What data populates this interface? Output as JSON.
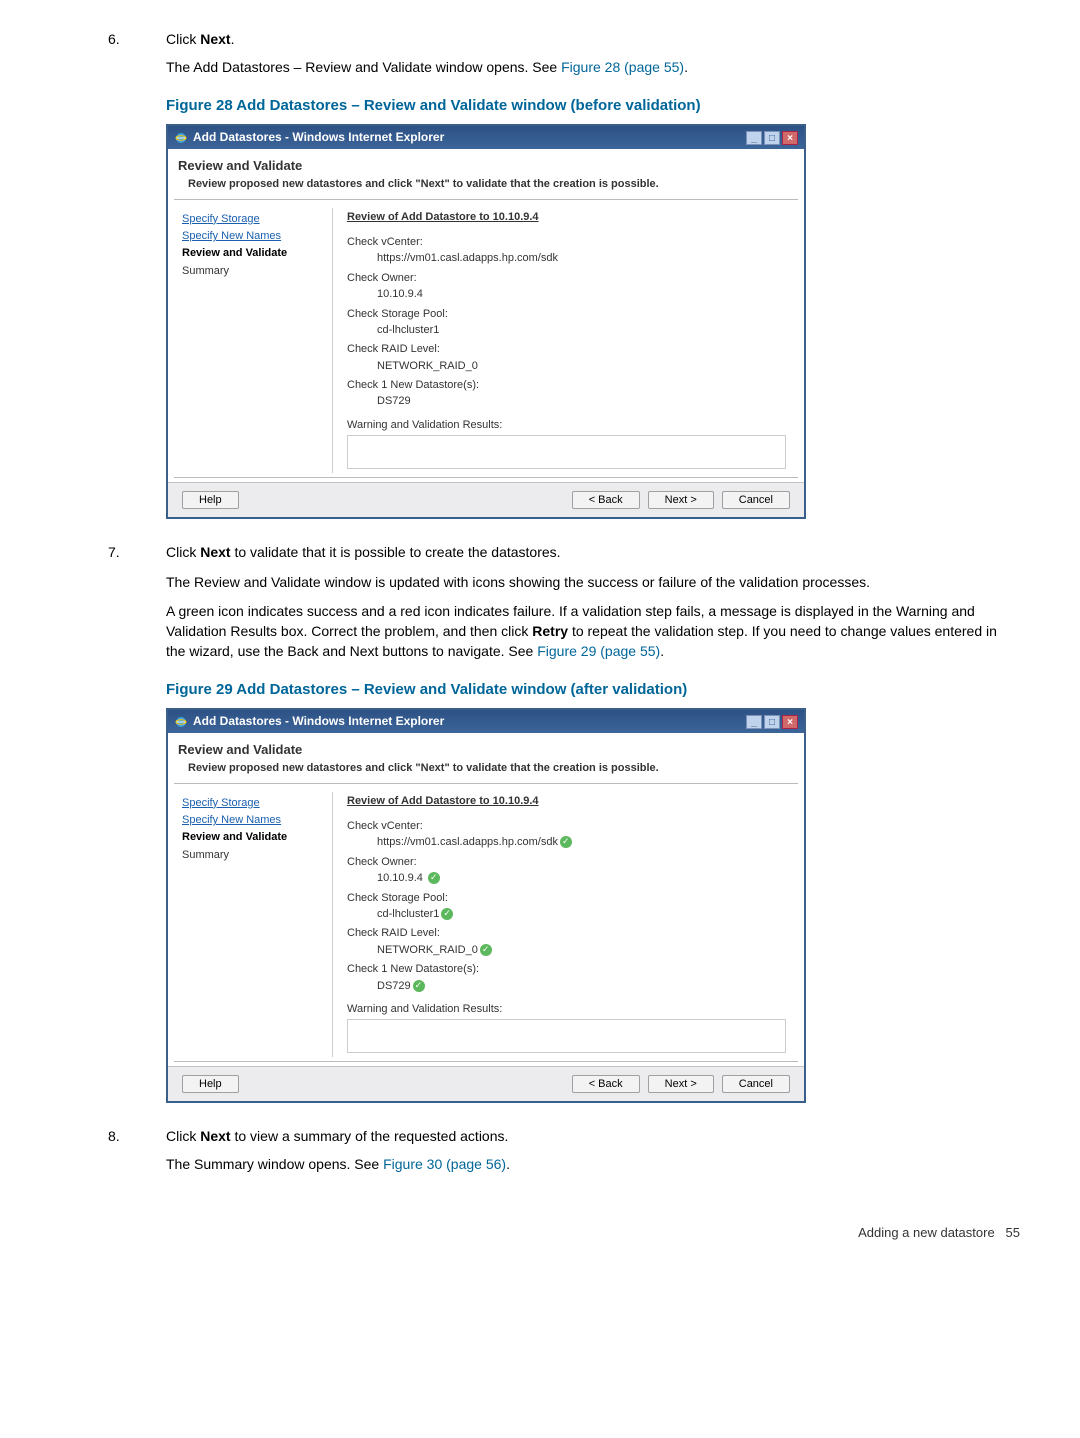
{
  "steps": {
    "s6": {
      "num": "6.",
      "p1a": "Click ",
      "p1b": "Next",
      "p1c": ".",
      "p2a": "The Add Datastores – Review and Validate window opens. See ",
      "p2link": "Figure 28 (page 55)",
      "p2b": "."
    },
    "s7": {
      "num": "7.",
      "p1a": "Click ",
      "p1b": "Next",
      "p1c": " to validate that it is possible to create the datastores.",
      "p2": "The Review and Validate window is updated with icons showing the success or failure of the validation processes.",
      "p3a": "A green icon indicates success and a red icon indicates failure. If a validation step fails, a message is displayed in the Warning and Validation Results box. Correct the problem, and then click ",
      "p3b": "Retry",
      "p3c": " to repeat the validation step. If you need to change values entered in the wizard, use the Back and Next buttons to navigate. See ",
      "p3link": "Figure 29 (page 55)",
      "p3d": "."
    },
    "s8": {
      "num": "8.",
      "p1a": "Click ",
      "p1b": "Next",
      "p1c": " to view a summary of the requested actions.",
      "p2a": "The Summary window opens. See ",
      "p2link": "Figure 30 (page 56)",
      "p2b": "."
    }
  },
  "fig28": {
    "caption": "Figure 28 Add Datastores – Review and Validate window (before validation)"
  },
  "fig29": {
    "caption": "Figure 29 Add Datastores – Review and Validate window (after validation)"
  },
  "dlg": {
    "title": "Add Datastores - Windows Internet Explorer",
    "header": "Review and Validate",
    "sub": "Review proposed new datastores and click \"Next\" to validate that the creation is possible.",
    "nav": {
      "a1": "Specify Storage",
      "a2": "Specify New Names",
      "cur": "Review and Validate",
      "p": "Summary"
    },
    "content": {
      "h": "Review of Add Datastore to 10.10.9.4",
      "c1": "Check vCenter:",
      "v1": "https://vm01.casl.adapps.hp.com/sdk",
      "c2": "Check Owner:",
      "v2": "10.10.9.4",
      "c3": "Check Storage Pool:",
      "v3": "cd-lhcluster1",
      "c4": "Check RAID Level:",
      "v4": "NETWORK_RAID_0",
      "c5": "Check 1 New Datastore(s):",
      "v5": "DS729",
      "warn": "Warning and Validation Results:"
    },
    "btn": {
      "help": "Help",
      "back": "< Back",
      "next": "Next >",
      "cancel": "Cancel"
    }
  },
  "footer": {
    "label": "Adding a new datastore",
    "page": "55"
  }
}
